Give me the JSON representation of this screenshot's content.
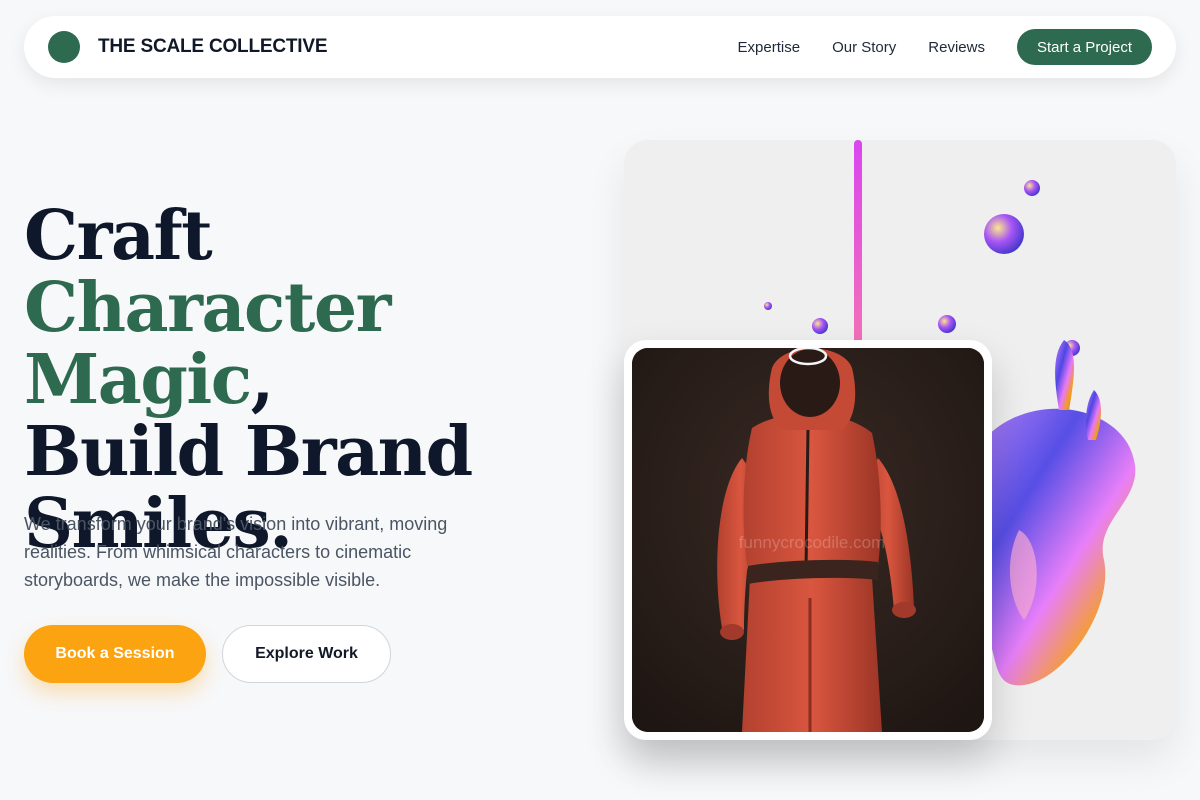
{
  "nav": {
    "brand": "THE SCALE COLLECTIVE",
    "links": [
      "Expertise",
      "Our Story",
      "Reviews"
    ],
    "cta": "Start a Project"
  },
  "hero": {
    "headline": {
      "word1": "Craft",
      "accent": "Character Magic",
      "comma": ",",
      "line3": "Build Brand",
      "line4": "Smiles."
    },
    "subtext": "We transform your brand's vision into vibrant, moving realities. From whimsical characters to cinematic storyboards, we make the impossible visible.",
    "primary_button": "Book a Session",
    "secondary_button": "Explore Work"
  },
  "media": {
    "watermark": "funnycrocodile.com"
  },
  "colors": {
    "accent": "#2d6a4f",
    "primary_button": "#fca311",
    "heading": "#0f172a",
    "body_text": "#4b5563",
    "background": "#f7f8fa"
  }
}
